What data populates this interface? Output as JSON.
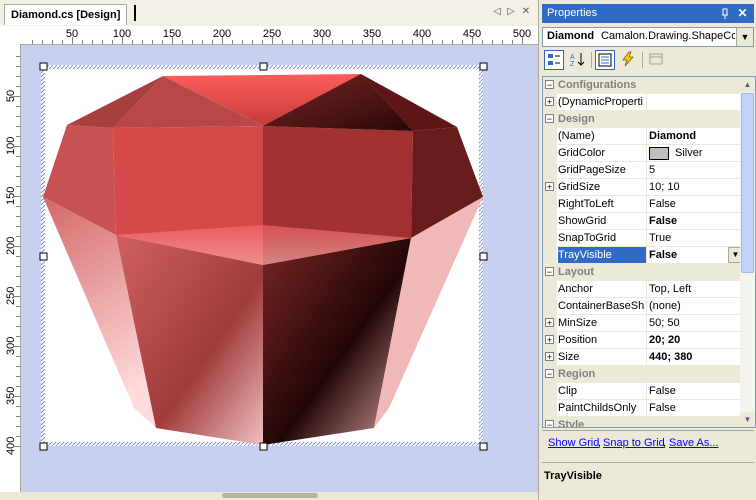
{
  "designer": {
    "tab_title": "Diamond.cs [Design]",
    "tab_controls": {
      "left": "◁",
      "right": "▷",
      "close": "✕"
    },
    "ruler_h": [
      "50",
      "100",
      "150",
      "200",
      "250",
      "300",
      "350",
      "400",
      "450",
      "500"
    ],
    "ruler_v": [
      "50",
      "100",
      "150",
      "200",
      "250",
      "300",
      "350",
      "400"
    ]
  },
  "props": {
    "title": "Properties",
    "pin_icon": "pin-icon",
    "object_name": "Diamond",
    "object_type": "Camalon.Drawing.ShapeCo",
    "rows": [
      {
        "kind": "cat",
        "label": "Configurations"
      },
      {
        "kind": "prop",
        "expand": true,
        "name": "(DynamicProperti",
        "value": ""
      },
      {
        "kind": "cat",
        "label": "Design"
      },
      {
        "kind": "prop",
        "name": "(Name)",
        "value": "Diamond",
        "bold": true
      },
      {
        "kind": "prop",
        "name": "GridColor",
        "value": "Silver",
        "swatch": "#c0c0c0"
      },
      {
        "kind": "prop",
        "name": "GridPageSize",
        "value": "5"
      },
      {
        "kind": "prop",
        "expand": true,
        "name": "GridSize",
        "value": "10; 10"
      },
      {
        "kind": "prop",
        "name": "RightToLeft",
        "value": "False"
      },
      {
        "kind": "prop",
        "name": "ShowGrid",
        "value": "False",
        "bold": true
      },
      {
        "kind": "prop",
        "name": "SnapToGrid",
        "value": "True"
      },
      {
        "kind": "prop",
        "name": "TrayVisible",
        "value": "False",
        "bold": true,
        "selected": true,
        "dropdown": true
      },
      {
        "kind": "cat",
        "label": "Layout"
      },
      {
        "kind": "prop",
        "name": "Anchor",
        "value": "Top, Left"
      },
      {
        "kind": "prop",
        "name": "ContainerBaseSh",
        "value": "(none)"
      },
      {
        "kind": "prop",
        "expand": true,
        "name": "MinSize",
        "value": "50; 50"
      },
      {
        "kind": "prop",
        "expand": true,
        "name": "Position",
        "value": "20; 20",
        "bold": true
      },
      {
        "kind": "prop",
        "expand": true,
        "name": "Size",
        "value": "440; 380",
        "bold": true
      },
      {
        "kind": "cat",
        "label": "Region"
      },
      {
        "kind": "prop",
        "name": "Clip",
        "value": "False"
      },
      {
        "kind": "prop",
        "name": "PaintChildsOnly",
        "value": "False"
      },
      {
        "kind": "cat",
        "label": "Style"
      }
    ],
    "commands": {
      "show_grid": "Show Grid",
      "snap_to_grid": "Snap to Grid",
      "save_as": "Save As..."
    },
    "description_title": "TrayVisible"
  }
}
